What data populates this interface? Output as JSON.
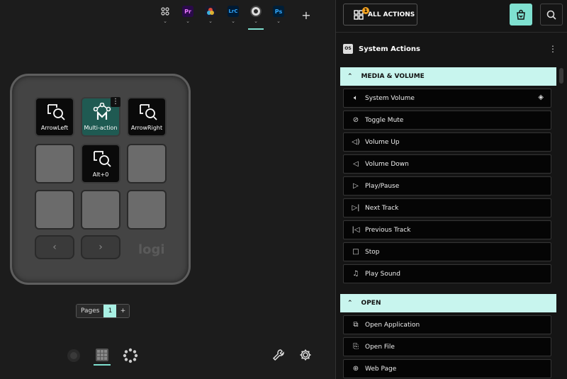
{
  "app_tabs": [
    {
      "name": "all-apps",
      "label": ""
    },
    {
      "name": "premiere",
      "label": "Pr",
      "bg": "#2a0a4a",
      "fg": "#ea77ff"
    },
    {
      "name": "davinci",
      "label": "",
      "bg": "#1a1a2a",
      "fg": "#fff"
    },
    {
      "name": "lightroom",
      "label": "LrC",
      "bg": "#001a33",
      "fg": "#31a8ff"
    },
    {
      "name": "obs",
      "label": "",
      "bg": "#2a2a2a",
      "fg": "#fff"
    },
    {
      "name": "photoshop",
      "label": "Ps",
      "bg": "#001e36",
      "fg": "#31a8ff"
    }
  ],
  "device": {
    "keys": [
      {
        "label": "ArrowLeft"
      },
      {
        "label": "Multi-action"
      },
      {
        "label": "ArrowRight"
      },
      {
        "label": "Alt+0"
      }
    ],
    "logo": "logi",
    "nav_prev": "‹",
    "nav_next": "›"
  },
  "pages": {
    "label": "Pages",
    "current": "1",
    "add": "+"
  },
  "panel": {
    "all_actions_label": "ALL ACTIONS",
    "badge": "1",
    "section_title": "System Actions",
    "os_badge": "OS",
    "groups": [
      {
        "title": "MEDIA & VOLUME",
        "items": [
          {
            "label": "System Volume",
            "icon": "speaker-icon"
          },
          {
            "label": "Toggle Mute",
            "icon": "mute-icon"
          },
          {
            "label": "Volume Up",
            "icon": "volume-up-icon"
          },
          {
            "label": "Volume Down",
            "icon": "volume-down-icon"
          },
          {
            "label": "Play/Pause",
            "icon": "play-icon"
          },
          {
            "label": "Next Track",
            "icon": "next-track-icon"
          },
          {
            "label": "Previous Track",
            "icon": "previous-track-icon"
          },
          {
            "label": "Stop",
            "icon": "stop-icon"
          },
          {
            "label": "Play Sound",
            "icon": "music-note-icon"
          }
        ]
      },
      {
        "title": "OPEN",
        "items": [
          {
            "label": "Open Application",
            "icon": "open-app-icon"
          },
          {
            "label": "Open File",
            "icon": "open-file-icon"
          },
          {
            "label": "Web Page",
            "icon": "globe-icon"
          }
        ]
      }
    ]
  },
  "colors": {
    "accent": "#7fe0d0",
    "header": "#c8f5ee",
    "badge": "#f0a020"
  }
}
